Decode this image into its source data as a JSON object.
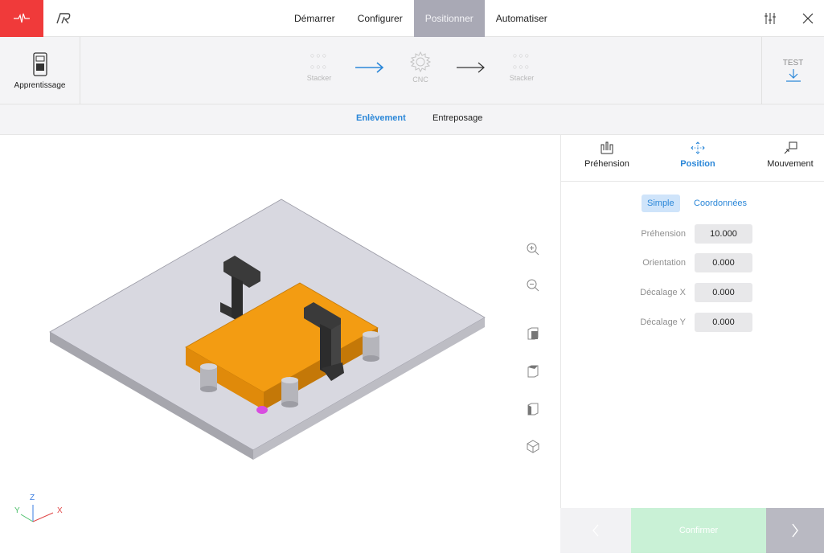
{
  "header": {
    "tabs": [
      {
        "label": "Démarrer",
        "active": false
      },
      {
        "label": "Configurer",
        "active": false
      },
      {
        "label": "Positionner",
        "active": true
      },
      {
        "label": "Automatiser",
        "active": false
      }
    ],
    "icons": [
      "pulse-icon",
      "robotiq-logo",
      "sliders-icon",
      "close-icon"
    ],
    "accent_color": "#f03a3a"
  },
  "wizard": {
    "teach_label": "Apprentissage",
    "steps": [
      {
        "label": "Stacker",
        "icon": "dots"
      },
      {
        "label": "CNC",
        "icon": "gear"
      },
      {
        "label": "Stacker",
        "icon": "dots"
      }
    ],
    "test_label": "TEST"
  },
  "subtabs": [
    {
      "label": "Enlèvement",
      "active": true
    },
    {
      "label": "Entreposage",
      "active": false
    }
  ],
  "panel": {
    "tabs": [
      {
        "label": "Préhension",
        "active": false
      },
      {
        "label": "Position",
        "active": true
      },
      {
        "label": "Mouvement",
        "active": false
      }
    ],
    "modes": [
      {
        "label": "Simple",
        "active": true
      },
      {
        "label": "Coordonnées",
        "active": false
      }
    ],
    "fields": [
      {
        "label": "Préhension",
        "value": "10.000"
      },
      {
        "label": "Orientation",
        "value": "0.000"
      },
      {
        "label": "Décalage X",
        "value": "0.000"
      },
      {
        "label": "Décalage Y",
        "value": "0.000"
      }
    ],
    "confirm_label": "Confirmer"
  },
  "viewport": {
    "axes": {
      "x": "X",
      "y": "Y",
      "z": "Z"
    },
    "tools": [
      "zoom-in-icon",
      "zoom-out-icon",
      "view-front-icon",
      "view-top-icon",
      "view-side-icon",
      "view-iso-icon"
    ],
    "part_color": "#f39c12"
  }
}
